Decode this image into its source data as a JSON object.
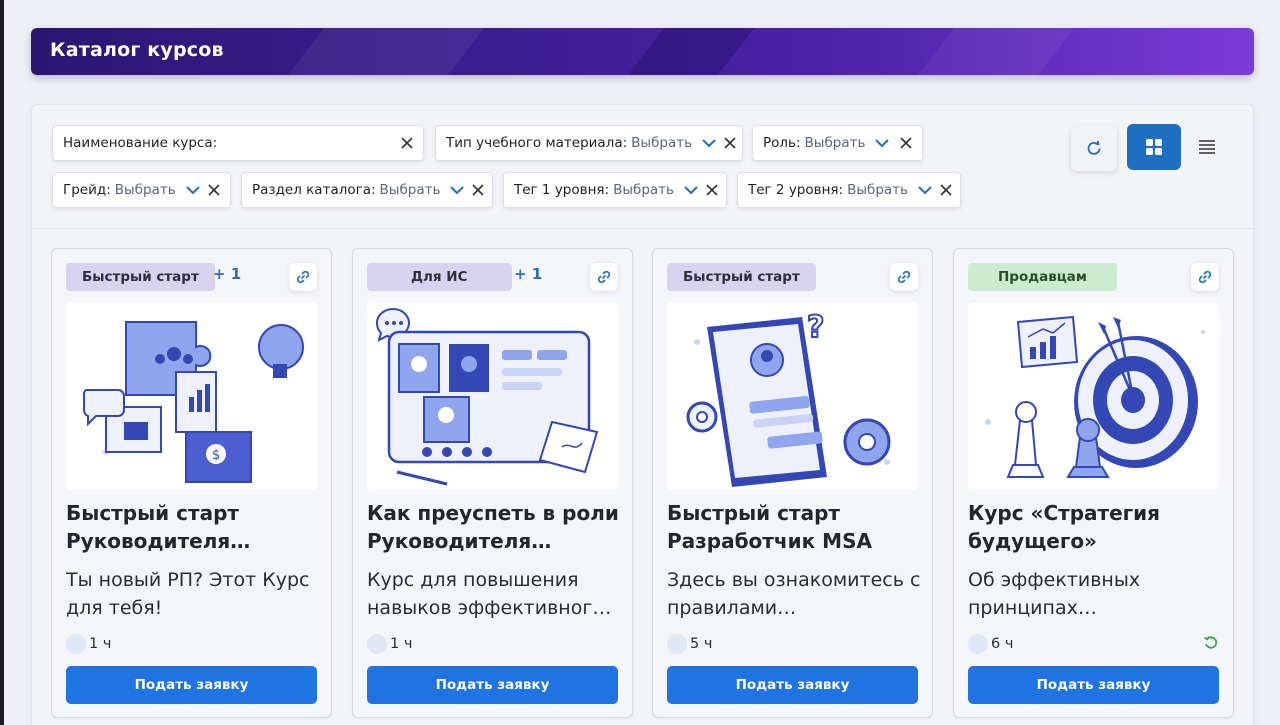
{
  "header": {
    "title": "Каталог курсов"
  },
  "filters": {
    "name": {
      "label": "Наименование курса:"
    },
    "material_type": {
      "label": "Тип учебного материала:",
      "value": "Выбрать"
    },
    "role": {
      "label": "Роль:",
      "value": "Выбрать"
    },
    "grade": {
      "label": "Грейд:",
      "value": "Выбрать"
    },
    "section": {
      "label": "Раздел каталога:",
      "value": "Выбрать"
    },
    "tag1": {
      "label": "Тег 1 уровня:",
      "value": "Выбрать"
    },
    "tag2": {
      "label": "Тег 2 уровня:",
      "value": "Выбрать"
    }
  },
  "colors": {
    "header_start": "#2a1772",
    "header_end": "#7b3bd6",
    "primary": "#1f73e3",
    "grid_active": "#1d6fc2",
    "badge_purple": "#d8d3ee",
    "badge_green": "#ccebcf"
  },
  "icons": {
    "refresh": "refresh-icon",
    "grid": "grid-view-icon",
    "list": "list-view-icon",
    "link": "link-icon",
    "clear": "close-icon",
    "chevron": "chevron-down-icon",
    "repeat": "repeat-icon"
  },
  "cards": [
    {
      "badge": "Быстрый старт",
      "extra_tags": "+ 1",
      "title": "Быстрый старт Руководителя…",
      "description": "Ты новый РП? Этот Курс для тебя!",
      "duration": "1 ч",
      "button": "Подать заявку"
    },
    {
      "badge": "Для ИС",
      "extra_tags": "+ 1",
      "title": "Как преуспеть в роли Руководителя…",
      "description": "Курс для повышения навыков эффективног…",
      "duration": "1 ч",
      "button": "Подать заявку"
    },
    {
      "badge": "Быстрый старт",
      "title": "Быстрый старт Разработчик MSA",
      "description": "Здесь вы ознакомитесь с правилами…",
      "duration": "5 ч",
      "button": "Подать заявку"
    },
    {
      "badge": "Продавцам",
      "title": "Курс «Стратегия будущего»",
      "description": "Об эффективных принципах…",
      "duration": "6 ч",
      "button": "Подать заявку"
    }
  ]
}
